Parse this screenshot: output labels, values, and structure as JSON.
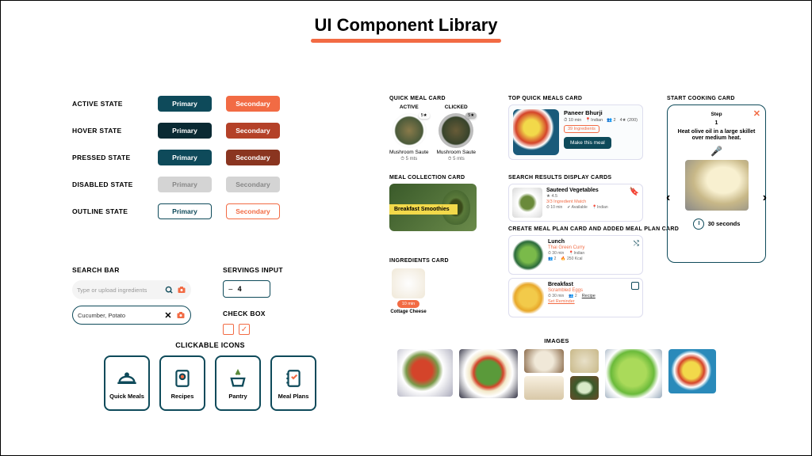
{
  "page": {
    "title": "UI Component Library"
  },
  "buttons": {
    "states": [
      "ACTIVE STATE",
      "HOVER  STATE",
      "PRESSED STATE",
      "DISABLED  STATE",
      "OUTLINE STATE"
    ],
    "primary": "Primary",
    "secondary": "Secondary"
  },
  "search": {
    "label": "SEARCH BAR",
    "placeholder": "Type or upload ingredients",
    "filled_value": "Cucumber, Potato"
  },
  "servings": {
    "label": "SERVINGS INPUT",
    "value": "4"
  },
  "checkbox": {
    "label": "CHECK BOX"
  },
  "clickable_icons": {
    "label": "CLICKABLE ICONS",
    "items": [
      "Quick Meals",
      "Recipes",
      "Pantry",
      "Meal Plans"
    ]
  },
  "quick_meal": {
    "label": "QUICK MEAL CARD",
    "states": [
      "ACTIVE",
      "CLICKED"
    ],
    "rating": "5★",
    "name": "Mushroom Saute",
    "time": "⏱ 5 mts"
  },
  "collection": {
    "label": "MEAL COLLECTION CARD",
    "title": "Breakfast Smoothies"
  },
  "ingredient": {
    "label": "INGREDIENTS  CARD",
    "pill": "10 min",
    "name": "Cottage Cheese"
  },
  "top_meal": {
    "label": "TOP QUICK MEALS CARD",
    "name": "Paneer Bhurji",
    "meta_time": "⏱ 10 min",
    "meta_cuisine": "📍Indian",
    "meta_serves": "👥 2",
    "meta_rating": "4★ (200)",
    "ingredients_tag": "39 Ingredients",
    "cta": "Make this meal"
  },
  "search_results": {
    "label": "SEARCH RESULTS DISPLAY CARDS",
    "name": "Sauteed Vegetables",
    "rating": "★ 4.5",
    "match": "3/3 Ingredient Match",
    "time": "⏱ 10 min",
    "avail": "✔ Available",
    "cuisine": "📍Indian"
  },
  "meal_plan": {
    "label": "CREATE MEAL PLAN CARD AND ADDED MEAL PLAN CARD",
    "card1": {
      "meal": "Lunch",
      "dish": "Thai Green Curry",
      "time": "⏱ 30 min",
      "cuisine": "📍Indian",
      "serves": "👥 2",
      "cal": "🔥 250 Kcal"
    },
    "card2": {
      "meal": "Breakfast",
      "dish": "Scrambled Eggs",
      "time": "⏱ 30 min",
      "serves": "👥 2",
      "recipe": "Recipe",
      "reminder": "Set Reminder"
    }
  },
  "cooking": {
    "label": "START COOKING CARD",
    "step_label": "Step",
    "step_num": "1",
    "instruction": "Heat olive oil in a large skillet over medium heat.",
    "timer": "30 seconds"
  },
  "images": {
    "label": "IMAGES"
  }
}
